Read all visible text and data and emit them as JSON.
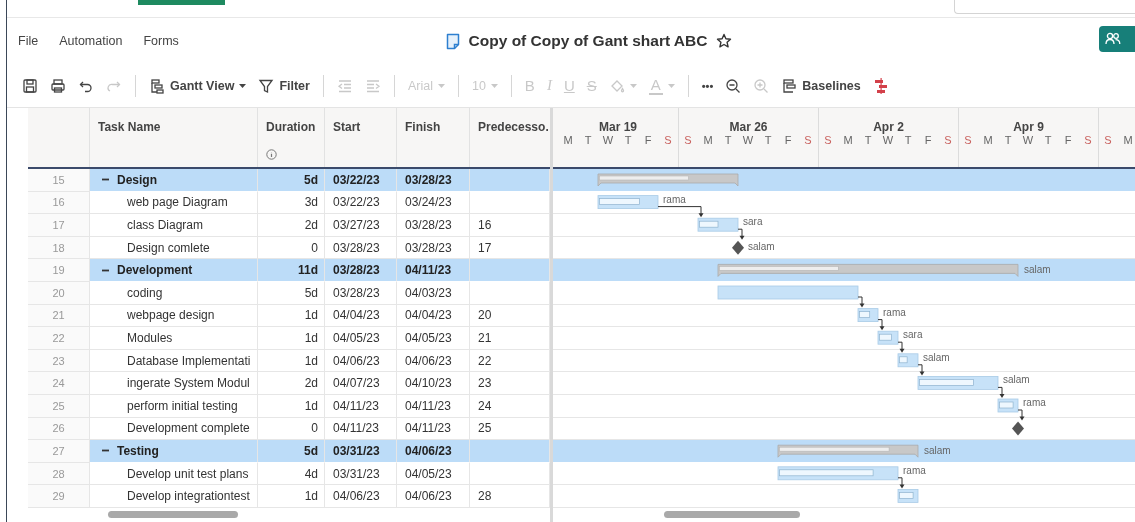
{
  "menu": [
    "File",
    "Automation",
    "Forms"
  ],
  "title": {
    "text": "Copy of Copy of Gant shart ABC",
    "starred": false
  },
  "toolbar": [
    {
      "kind": "save",
      "disabled": false
    },
    {
      "kind": "print",
      "disabled": false
    },
    {
      "kind": "undo",
      "disabled": false
    },
    {
      "kind": "redo",
      "disabled": true
    },
    {
      "kind": "separator"
    },
    {
      "kind": "view",
      "label": "Gantt View",
      "disabled": false
    },
    {
      "kind": "filter",
      "label": "Filter",
      "disabled": false
    },
    {
      "kind": "separator"
    },
    {
      "kind": "outdent",
      "disabled": true
    },
    {
      "kind": "indent",
      "disabled": true
    },
    {
      "kind": "separator"
    },
    {
      "kind": "font",
      "label": "Arial",
      "disabled": true
    },
    {
      "kind": "separator"
    },
    {
      "kind": "size",
      "label": "10",
      "disabled": true
    },
    {
      "kind": "separator"
    },
    {
      "kind": "bold",
      "label": "B",
      "disabled": true
    },
    {
      "kind": "italic",
      "label": "I",
      "disabled": true
    },
    {
      "kind": "underline",
      "label": "U",
      "disabled": true
    },
    {
      "kind": "strike",
      "label": "S",
      "disabled": true
    },
    {
      "kind": "fill",
      "disabled": true
    },
    {
      "kind": "color",
      "label": "A",
      "disabled": true
    },
    {
      "kind": "separator"
    },
    {
      "kind": "more",
      "label": "•••",
      "disabled": false
    },
    {
      "kind": "zoom-out",
      "disabled": false
    },
    {
      "kind": "zoom-in",
      "disabled": true
    },
    {
      "kind": "baselines",
      "label": "Baselines",
      "disabled": false
    },
    {
      "kind": "gantt",
      "disabled": false
    }
  ],
  "columns": [
    {
      "label": "Task Name"
    },
    {
      "label": "Duration"
    },
    {
      "label": "Start"
    },
    {
      "label": "Finish"
    },
    {
      "label": "Predecesso."
    }
  ],
  "timeline": [
    {
      "label": "Mar 19",
      "days": [
        {
          "d": "M",
          "weekend": false
        },
        {
          "d": "T",
          "weekend": false
        },
        {
          "d": "W",
          "weekend": false
        },
        {
          "d": "T",
          "weekend": false
        },
        {
          "d": "F",
          "weekend": false
        },
        {
          "d": "S",
          "weekend": true
        }
      ]
    },
    {
      "label": "Mar 26",
      "days": [
        {
          "d": "S",
          "weekend": true
        },
        {
          "d": "M",
          "weekend": false
        },
        {
          "d": "T",
          "weekend": false
        },
        {
          "d": "W",
          "weekend": false
        },
        {
          "d": "T",
          "weekend": false
        },
        {
          "d": "F",
          "weekend": false
        },
        {
          "d": "S",
          "weekend": true
        }
      ]
    },
    {
      "label": "Apr 2",
      "days": [
        {
          "d": "S",
          "weekend": true
        },
        {
          "d": "M",
          "weekend": false
        },
        {
          "d": "T",
          "weekend": false
        },
        {
          "d": "W",
          "weekend": false
        },
        {
          "d": "T",
          "weekend": false
        },
        {
          "d": "F",
          "weekend": false
        },
        {
          "d": "S",
          "weekend": true
        }
      ]
    },
    {
      "label": "Apr 9",
      "days": [
        {
          "d": "S",
          "weekend": true
        },
        {
          "d": "M",
          "weekend": false
        },
        {
          "d": "T",
          "weekend": false
        },
        {
          "d": "W",
          "weekend": false
        },
        {
          "d": "T",
          "weekend": false
        },
        {
          "d": "F",
          "weekend": false
        },
        {
          "d": "S",
          "weekend": true
        }
      ]
    },
    {
      "days": [
        {
          "d": "S",
          "weekend": true
        },
        {
          "d": "M",
          "weekend": false
        }
      ]
    }
  ],
  "rows": [
    {
      "num": "15",
      "kind": "summary",
      "expanded": true,
      "name": "Design",
      "duration": "5d",
      "start": "03/22/23",
      "finish": "03/28/23",
      "level": 0.65
    },
    {
      "num": "16",
      "kind": "task",
      "name": "web page Diagram",
      "duration": "3d",
      "start": "03/22/23",
      "finish": "03/24/23",
      "level": 0.7,
      "assignee": "rama"
    },
    {
      "num": "17",
      "kind": "task",
      "name": "class Diagram",
      "duration": "2d",
      "start": "03/27/23",
      "finish": "03/28/23",
      "predecessors": "16",
      "level": 0.5,
      "assignee": "sara"
    },
    {
      "num": "18",
      "kind": "milestone",
      "name": "Design comlete",
      "duration": "0",
      "start": "03/28/23",
      "finish": "03/28/23",
      "predecessors": "17",
      "assignee": "salam"
    },
    {
      "num": "19",
      "kind": "summary",
      "expanded": true,
      "name": "Development",
      "duration": "11d",
      "start": "03/28/23",
      "finish": "04/11/23",
      "level": 0.4,
      "assignee": "salam"
    },
    {
      "num": "20",
      "kind": "task",
      "name": "coding",
      "duration": "5d",
      "start": "03/28/23",
      "finish": "04/03/23"
    },
    {
      "num": "21",
      "kind": "task",
      "name": "webpage design",
      "duration": "1d",
      "start": "04/04/23",
      "finish": "04/04/23",
      "predecessors": "20",
      "level": 0.6,
      "assignee": "rama"
    },
    {
      "num": "22",
      "kind": "task",
      "name": "Modules",
      "duration": "1d",
      "start": "04/05/23",
      "finish": "04/05/23",
      "predecessors": "21",
      "level": 0.7,
      "assignee": "sara"
    },
    {
      "num": "23",
      "kind": "task",
      "name": "Database Implementati",
      "duration": "1d",
      "start": "04/06/23",
      "finish": "04/06/23",
      "predecessors": "22",
      "level": 0.45,
      "assignee": "salam"
    },
    {
      "num": "24",
      "kind": "task",
      "name": "ingerate System Modul",
      "duration": "2d",
      "start": "04/07/23",
      "finish": "04/10/23",
      "predecessors": "23",
      "level": 0.7,
      "assignee": "salam"
    },
    {
      "num": "25",
      "kind": "task",
      "name": "perform initial testing",
      "duration": "1d",
      "start": "04/11/23",
      "finish": "04/11/23",
      "predecessors": "24",
      "level": 0.8,
      "assignee": "rama"
    },
    {
      "num": "26",
      "kind": "milestone",
      "name": "Development complete",
      "duration": "0",
      "start": "04/11/23",
      "finish": "04/11/23",
      "predecessors": "25"
    },
    {
      "num": "27",
      "kind": "summary",
      "expanded": true,
      "name": "Testing",
      "duration": "5d",
      "start": "03/31/23",
      "finish": "04/06/23",
      "level": 0.8,
      "assignee": "salam"
    },
    {
      "num": "28",
      "kind": "task",
      "name": "Develop unit test plans",
      "duration": "4d",
      "start": "03/31/23",
      "finish": "04/05/23",
      "level": 0.8,
      "assignee": "rama"
    },
    {
      "num": "29",
      "kind": "task",
      "name": "Develop integrationtest",
      "duration": "1d",
      "start": "04/06/23",
      "finish": "04/06/23",
      "predecessors": "28",
      "level": 0.8
    }
  ]
}
